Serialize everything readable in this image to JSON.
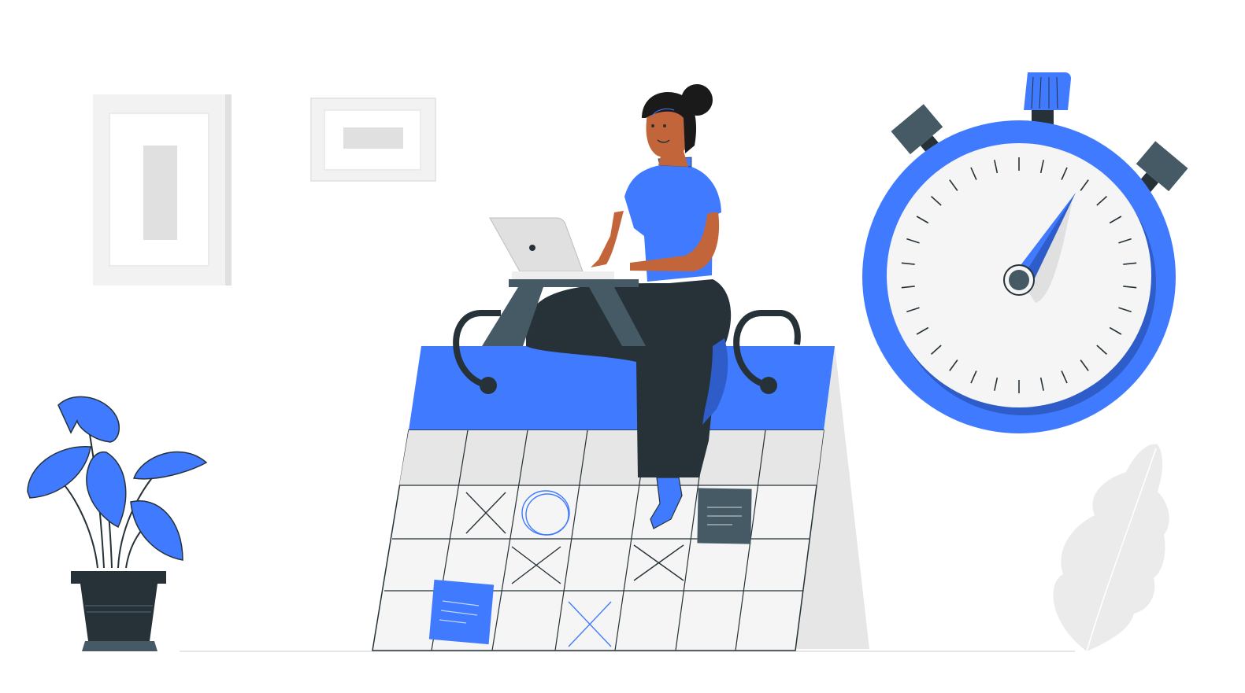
{
  "scene": {
    "colors": {
      "accent": "#407BFF",
      "accent_dark": "#2E5CC8",
      "ink": "#263238",
      "slate": "#455A64",
      "skin": "#C2653A",
      "paper": "#F5F5F5",
      "grey": "#E0E0E0",
      "frame": "#EBEBEB"
    },
    "illustration": {
      "icons": [
        "wall-frame-icon",
        "plant-icon",
        "calendar-icon",
        "woman-icon",
        "laptop-icon",
        "stopwatch-icon",
        "leaf-icon",
        "sticky-note-icon"
      ],
      "calendar_marks": [
        "x",
        "x",
        "circle",
        "x",
        "x"
      ]
    }
  }
}
